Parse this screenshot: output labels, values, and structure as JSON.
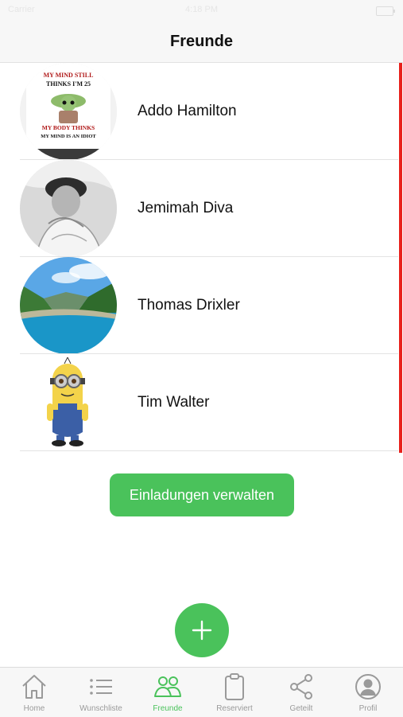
{
  "status_bar": {
    "carrier": "Carrier",
    "time": "4:18 PM"
  },
  "nav": {
    "title": "Freunde"
  },
  "friends": [
    {
      "name": "Addo Hamilton",
      "avatar_text": [
        "MY MIND STILL",
        "THINKS I'M 25",
        "MY BODY THINKS",
        "MY MIND IS AN IDIOT"
      ]
    },
    {
      "name": "Jemimah Diva"
    },
    {
      "name": "Thomas Drixler"
    },
    {
      "name": "Tim Walter"
    }
  ],
  "actions": {
    "invite_label": "Einladungen verwalten",
    "add_icon": "plus-icon"
  },
  "colors": {
    "accent": "#4ac25b",
    "scroll_indicator": "#e8201b",
    "tab_inactive": "#9a9a9a"
  },
  "tabs": [
    {
      "label": "Home",
      "icon": "home-icon",
      "active": false
    },
    {
      "label": "Wunschliste",
      "icon": "list-icon",
      "active": false
    },
    {
      "label": "Freunde",
      "icon": "friends-icon",
      "active": true
    },
    {
      "label": "Reserviert",
      "icon": "clipboard-icon",
      "active": false
    },
    {
      "label": "Geteilt",
      "icon": "share-icon",
      "active": false
    },
    {
      "label": "Profil",
      "icon": "profile-icon",
      "active": false
    }
  ]
}
